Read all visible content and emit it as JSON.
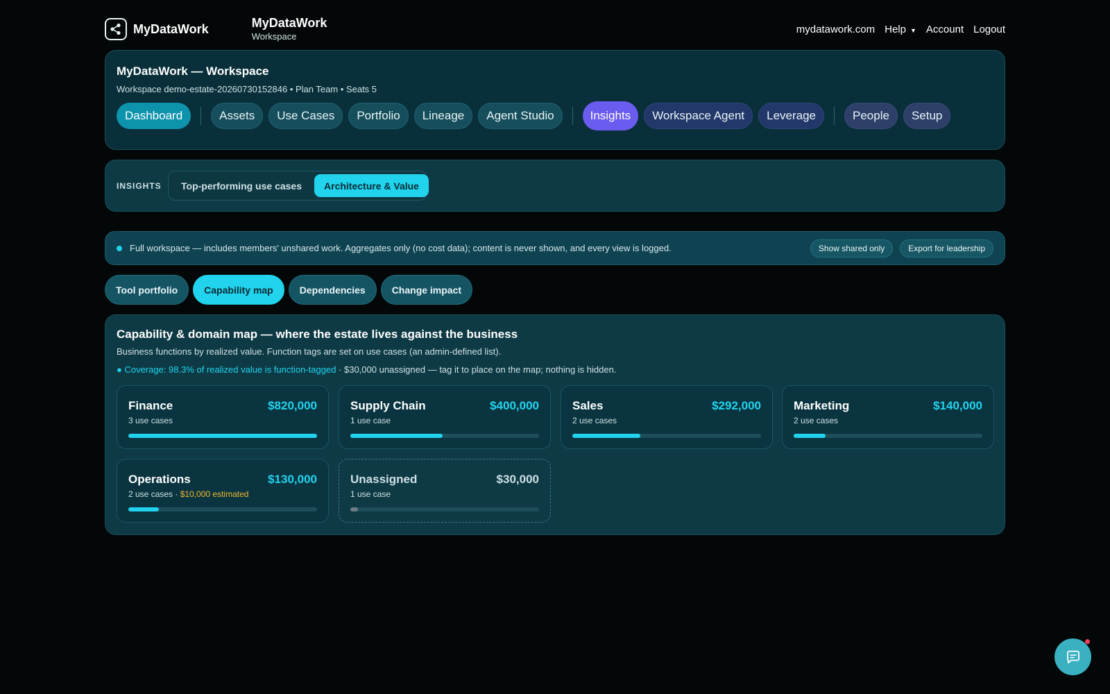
{
  "app": {
    "brand": "MyDataWork",
    "workspace_title": "MyDataWork",
    "workspace_subtitle": "Workspace"
  },
  "top_links": {
    "site": "mydatawork.com",
    "help": "Help",
    "account": "Account",
    "logout": "Logout"
  },
  "workspace": {
    "title": "MyDataWork — Workspace",
    "meta": "Workspace demo-estate-20260730152846 • Plan Team • Seats 5"
  },
  "nav": [
    {
      "label": "Dashboard",
      "active": true
    },
    {
      "label": "Assets"
    },
    {
      "label": "Use Cases"
    },
    {
      "label": "Portfolio"
    },
    {
      "label": "Lineage"
    },
    {
      "label": "Agent Studio"
    },
    {
      "label": "Insights",
      "active": true
    },
    {
      "label": "Workspace Agent"
    },
    {
      "label": "Leverage"
    },
    {
      "label": "People"
    },
    {
      "label": "Setup"
    }
  ],
  "insights": {
    "label": "INSIGHTS",
    "tabs": [
      "Top-performing use cases",
      "Architecture & Value"
    ],
    "selected": "Architecture & Value"
  },
  "notice": {
    "text": "Full workspace — includes members' unshared work. Aggregates only (no cost data); content is never shown, and every view is logged.",
    "buttons": [
      "Show shared only",
      "Export for leadership"
    ]
  },
  "subtabs": [
    "Tool portfolio",
    "Capability map",
    "Dependencies",
    "Change impact"
  ],
  "subtab_selected": "Capability map",
  "capability": {
    "title": "Capability & domain map — where the estate lives against the business",
    "subtitle": "Business functions by realized value. Function tags are set on use cases (an admin-defined list).",
    "coverage_highlight": "● Coverage: 98.3% of realized value is function-tagged",
    "coverage_rest": " · $30,000 unassigned — tag it to place on the map; nothing is hidden.",
    "cards": [
      {
        "name": "Finance",
        "value": "$820,000",
        "count": "3 use cases",
        "estimate": "",
        "fill": 1.0
      },
      {
        "name": "Supply Chain",
        "value": "$400,000",
        "count": "1 use case",
        "estimate": "",
        "fill": 0.49
      },
      {
        "name": "Sales",
        "value": "$292,000",
        "count": "2 use cases",
        "estimate": "",
        "fill": 0.36
      },
      {
        "name": "Marketing",
        "value": "$140,000",
        "count": "2 use cases",
        "estimate": "",
        "fill": 0.17
      },
      {
        "name": "Operations",
        "value": "$130,000",
        "count": "2 use cases · ",
        "estimate": "$10,000 estimated",
        "fill": 0.16
      },
      {
        "name": "Unassigned",
        "value": "$30,000",
        "count": "1 use case",
        "estimate": "",
        "fill": 0.04
      }
    ]
  },
  "colors": {
    "accent": "#22d3ee",
    "insights_active": "#6b5cf0",
    "estimate": "#f5b82e",
    "background": "#030708"
  }
}
